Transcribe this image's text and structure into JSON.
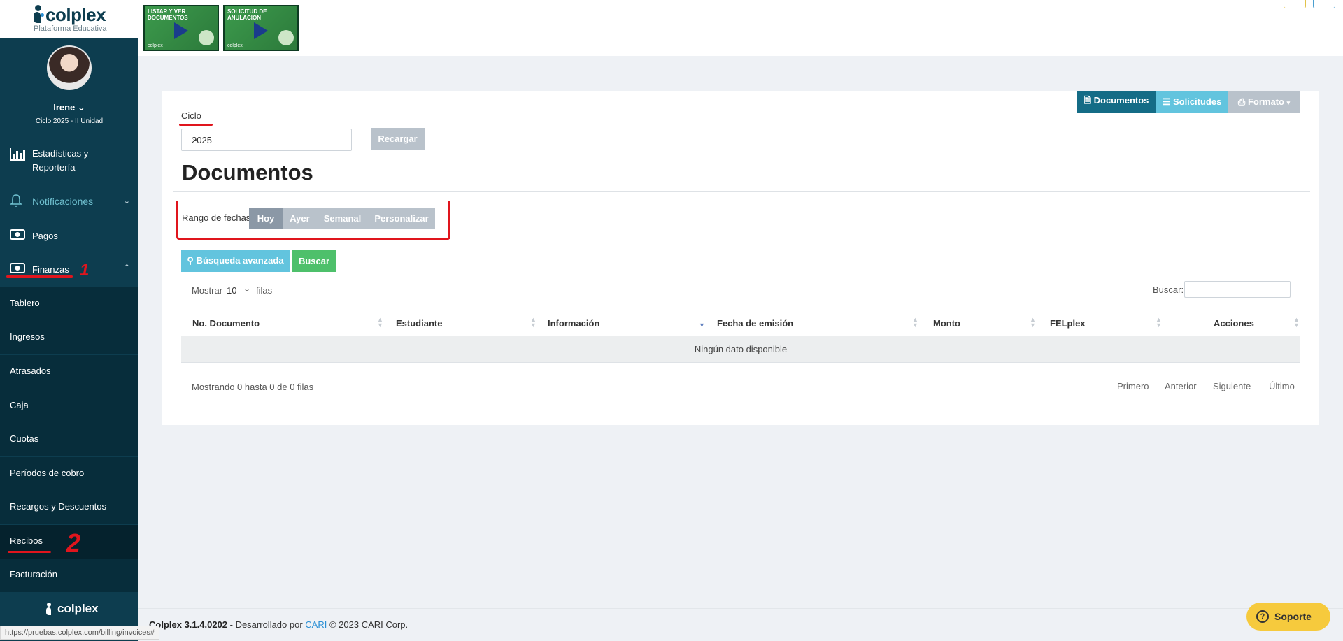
{
  "sidebar": {
    "logo_text": "colplex",
    "logo_sub": "Plataforma Educativa",
    "user_name": "Irene ⌄",
    "user_cycle": "Ciclo 2025 - II Unidad",
    "nav": {
      "estadisticas": "Estadísticas y Reportería",
      "notificaciones": "Notificaciones",
      "pagos": "Pagos",
      "finanzas": "Finanzas"
    },
    "sub_items": [
      "Tablero",
      "Ingresos",
      "Atrasados",
      "Caja",
      "Cuotas",
      "Períodos de cobro",
      "Recargos y Descuentos",
      "Recibos",
      "Facturación"
    ],
    "footer_logo": "colplex"
  },
  "topbar": {
    "video1_title": "LISTAR Y VER DOCUMENTOS",
    "video2_title": "SOLICITUD DE ANULACION",
    "video_brand": "colplex"
  },
  "annotations": {
    "mark1": "1",
    "mark2": "2"
  },
  "filters": {
    "ciclo_label": "Ciclo",
    "ciclo_value": "2025",
    "recargar": "Recargar"
  },
  "page": {
    "title": "Documentos",
    "tabs": [
      "Documentos",
      "Solicitudes",
      "Formato"
    ]
  },
  "range": {
    "label": "Rango de fechas",
    "options": [
      "Hoy",
      "Ayer",
      "Semanal",
      "Personalizar"
    ]
  },
  "actions": {
    "advanced": "Búsqueda avanzada",
    "search": "Buscar"
  },
  "table": {
    "show_label": "Mostrar",
    "show_value": "10",
    "rows_label": "filas",
    "search_label": "Buscar:",
    "columns": [
      "No. Documento",
      "Estudiante",
      "Información",
      "Fecha de emisión",
      "Monto",
      "FELplex",
      "Acciones"
    ],
    "empty": "Ningún dato disponible",
    "info": "Mostrando 0 hasta 0 de 0 filas",
    "pagination": [
      "Primero",
      "Anterior",
      "Siguiente",
      "Último"
    ]
  },
  "footer": {
    "version": "Colplex 3.1.4.0202",
    "dev": " - Desarrollado por ",
    "cari": "CARI",
    "copyright": " © 2023 CARI Corp."
  },
  "status_url": "https://pruebas.colplex.com/billing/invoices#",
  "support": "Soporte",
  "colors": {
    "sidebar": "#0d3d4f",
    "primary": "#146c86",
    "info": "#62c4de",
    "success": "#4ec06b",
    "annotation": "#e0151d"
  }
}
